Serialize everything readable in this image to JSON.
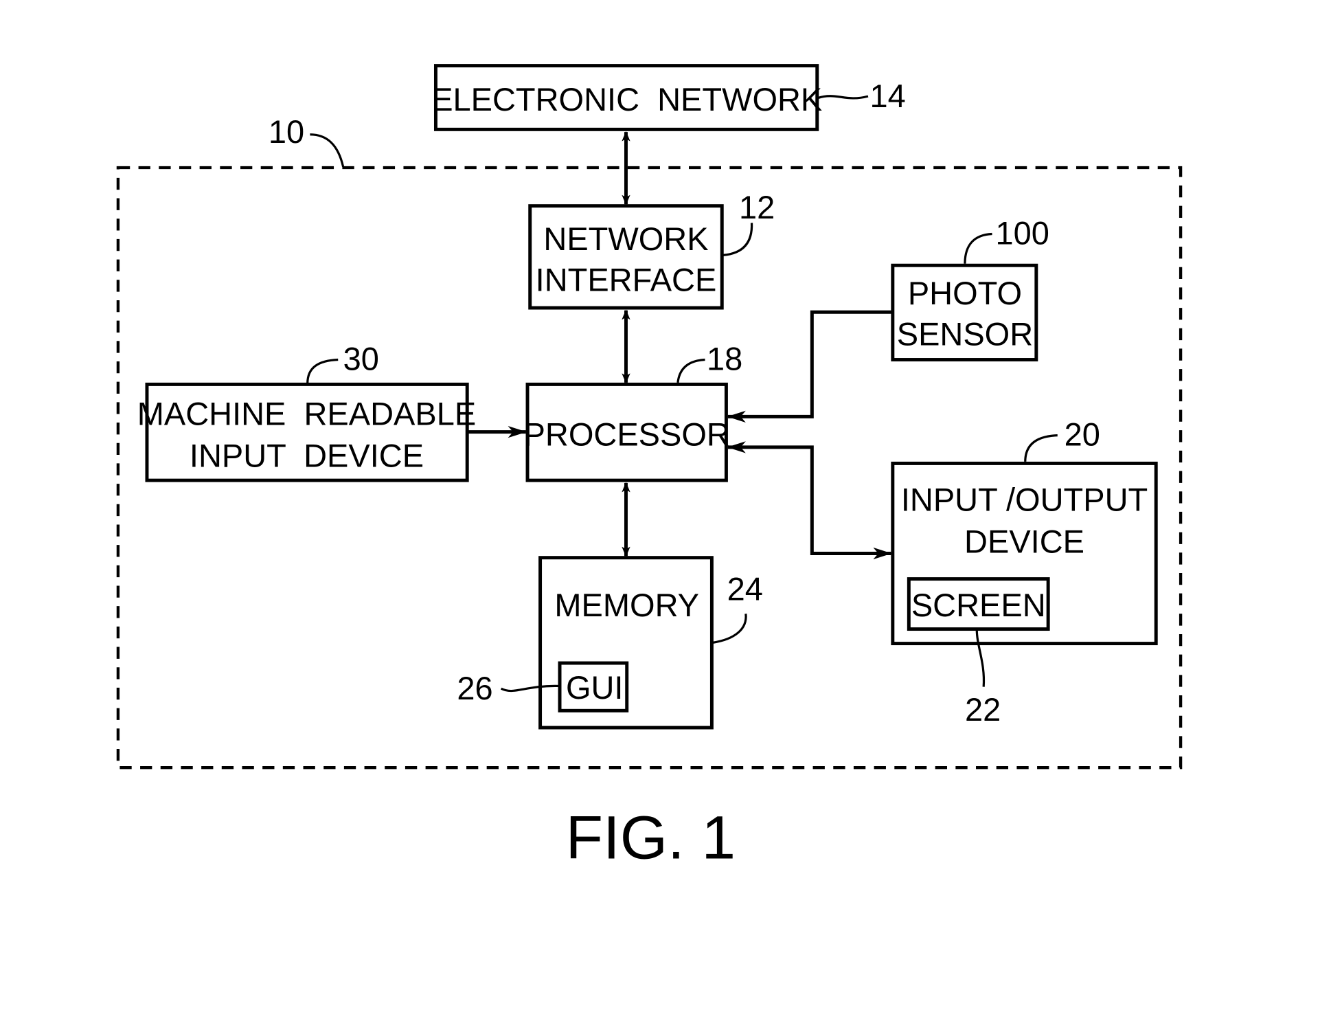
{
  "figure": {
    "caption": "FIG. 1",
    "system_ref": "10"
  },
  "blocks": {
    "electronic_network": {
      "label": [
        "ELECTRONIC  NETWORK"
      ],
      "ref": "14"
    },
    "network_interface": {
      "label": [
        "NETWORK",
        "INTERFACE"
      ],
      "ref": "12"
    },
    "photo_sensor": {
      "label": [
        "PHOTO",
        "SENSOR"
      ],
      "ref": "100"
    },
    "machine_readable_input_device": {
      "label": [
        "MACHINE  READABLE",
        "INPUT  DEVICE"
      ],
      "ref": "30"
    },
    "processor": {
      "label": [
        "PROCESSOR"
      ],
      "ref": "18"
    },
    "input_output_device": {
      "label": [
        "INPUT /OUTPUT",
        "DEVICE"
      ],
      "ref": "20"
    },
    "screen": {
      "label": [
        "SCREEN"
      ],
      "ref": "22"
    },
    "memory": {
      "label": [
        "MEMORY"
      ],
      "ref": "24"
    },
    "gui": {
      "label": [
        "GUI"
      ],
      "ref": "26"
    }
  },
  "connections": [
    {
      "from": "electronic_network",
      "to": "network_interface",
      "direction": "bidirectional"
    },
    {
      "from": "network_interface",
      "to": "processor",
      "direction": "bidirectional"
    },
    {
      "from": "machine_readable_input_device",
      "to": "processor",
      "direction": "one-way"
    },
    {
      "from": "photo_sensor",
      "to": "processor",
      "direction": "one-way"
    },
    {
      "from": "processor",
      "to": "input_output_device",
      "direction": "bidirectional"
    },
    {
      "from": "processor",
      "to": "memory",
      "direction": "bidirectional"
    }
  ]
}
